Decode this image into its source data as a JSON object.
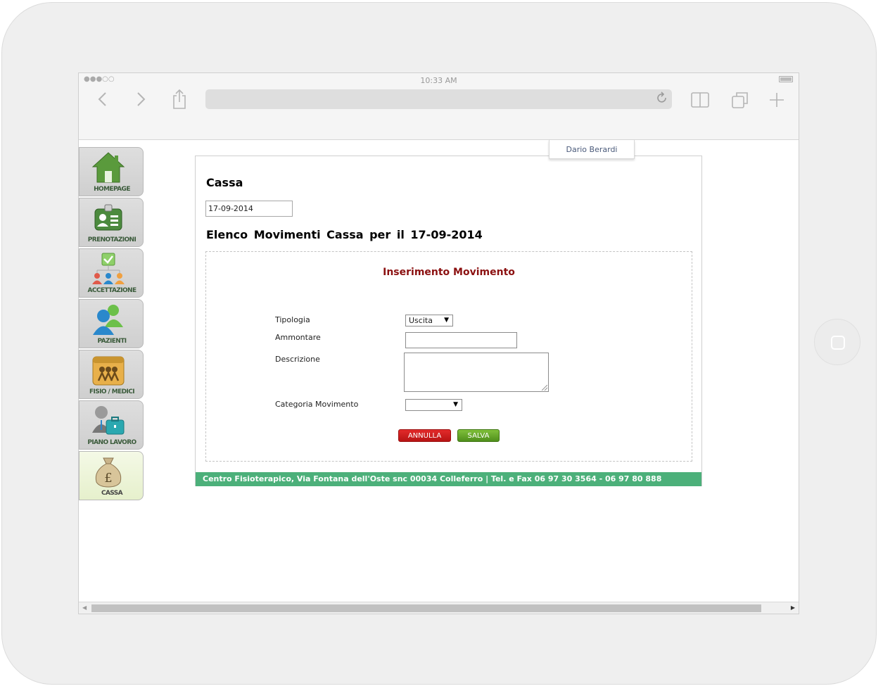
{
  "status_bar": {
    "signal": "●●●○○",
    "time": "10:33 AM"
  },
  "browser": {
    "back_icon": "chevron-left",
    "forward_icon": "chevron-right",
    "share_icon": "share",
    "reload_icon": "reload",
    "bookmarks_icon": "book",
    "tabs_icon": "tabs",
    "new_tab_icon": "plus"
  },
  "user": {
    "name": "Dario Berardi"
  },
  "sidebar": {
    "items": [
      {
        "label": "HOMEPAGE",
        "icon": "home-icon"
      },
      {
        "label": "PRENOTAZIONI",
        "icon": "id-card-icon"
      },
      {
        "label": "ACCETTAZIONE",
        "icon": "org-chart-icon"
      },
      {
        "label": "PAZIENTI",
        "icon": "users-icon"
      },
      {
        "label": "FISIO / MEDICI",
        "icon": "team-folder-icon"
      },
      {
        "label": "PIANO LAVORO",
        "icon": "briefcase-user-icon"
      },
      {
        "label": "CASSA",
        "icon": "money-bag-icon",
        "active": true
      }
    ]
  },
  "page": {
    "title": "Cassa",
    "date_value": "17-09-2014",
    "list_title": "Elenco Movimenti Cassa per il 17-09-2014"
  },
  "form": {
    "title": "Inserimento Movimento",
    "tipologia_label": "Tipologia",
    "tipologia_value": "Uscita",
    "ammontare_label": "Ammontare",
    "ammontare_value": "",
    "descrizione_label": "Descrizione",
    "descrizione_value": "",
    "categoria_label": "Categoria Movimento",
    "categoria_value": "",
    "cancel_label": "ANNULLA",
    "save_label": "SALVA"
  },
  "footer": {
    "text": "Centro Fisioterapico, Via Fontana dell'Oste snc 00034 Colleferro | Tel. e Fax 06 97 30 3564 - 06 97 80 888"
  },
  "colors": {
    "accent_green": "#4cb07a",
    "form_title": "#8b1010",
    "cancel": "#c81c1c",
    "save": "#5ea126"
  }
}
